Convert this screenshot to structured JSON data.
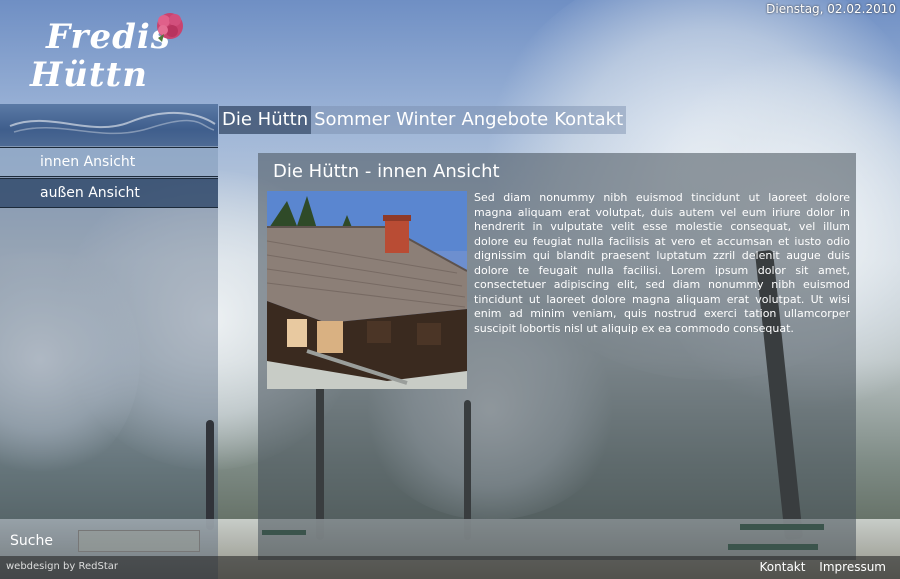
{
  "header": {
    "logo_line1": "Fredis",
    "logo_line2": "Hüttn",
    "date": "Dienstag, 02.02.2010"
  },
  "topnav": {
    "items": [
      {
        "label": "Die Hüttn",
        "active": true
      },
      {
        "label": "Sommer"
      },
      {
        "label": "Winter"
      },
      {
        "label": "Angebote"
      },
      {
        "label": "Kontakt"
      }
    ]
  },
  "subnav": {
    "items": [
      {
        "label": "innen Ansicht",
        "active": true
      },
      {
        "label": "außen Ansicht"
      }
    ]
  },
  "content": {
    "title": "Die Hüttn - innen Ansicht",
    "body": "Sed diam nonummy nibh euismod tincidunt ut laoreet dolore magna aliquam erat volutpat, duis autem vel eum iriure dolor in hendrerit in vulputate velit esse molestie consequat, vel illum dolore eu feugiat nulla facilisis at vero et accumsan et iusto odio dignissim qui blandit praesent luptatum zzril delenit augue duis dolore te feugait nulla facilisi. Lorem ipsum dolor sit amet, consectetuer adipiscing elit, sed diam nonummy nibh euismod tincidunt ut laoreet dolore magna aliquam erat volutpat. Ut wisi enim ad minim veniam, quis nostrud exerci tation ullamcorper suscipit lobortis nisl ut aliquip ex ea commodo consequat."
  },
  "search": {
    "label": "Suche",
    "value": ""
  },
  "footer": {
    "credit": "webdesign by RedStar",
    "links": [
      "Kontakt",
      "Impressum"
    ]
  }
}
